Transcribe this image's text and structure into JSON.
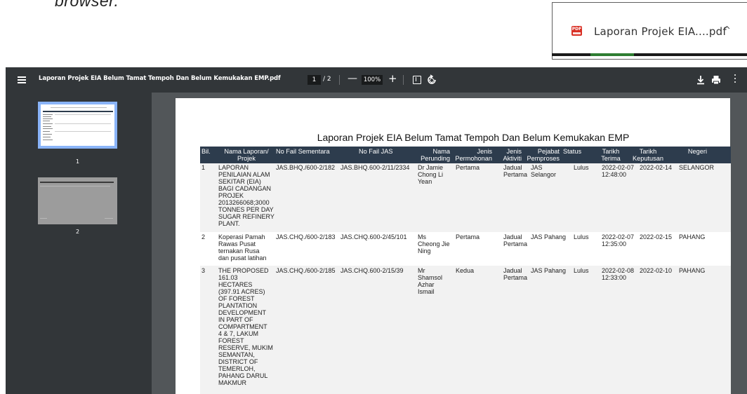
{
  "browser": {
    "cut_text": "browser.",
    "download": {
      "icon_label": "PDF",
      "file_name": "Laporan Projek EIA....pdf",
      "chevron": "^"
    }
  },
  "toolbar": {
    "file_title": "Laporan Projek EIA Belum Tamat Tempoh Dan Belum Kemukakan EMP.pdf",
    "page_current": "1",
    "page_total": "/ 2",
    "zoom_out": "—",
    "zoom": "100%",
    "zoom_in": "+"
  },
  "sidebar": {
    "thumbnails": [
      {
        "number": "1"
      },
      {
        "number": "2"
      }
    ]
  },
  "document": {
    "title": "Laporan Projek EIA Belum Tamat Tempoh Dan Belum Kemukakan EMP",
    "columns": [
      "Bil.",
      "Nama Laporan/\nProjek",
      "No Fail Sementara",
      "No Fail JAS",
      "Nama\nPerunding",
      "Jenis\nPermohonan",
      "Jenis\nAktiviti",
      "Pejabat\nPemproses",
      "Status",
      "Tarikh\nTerima",
      "Tarikh\nKeputusan",
      "Negeri"
    ],
    "rows": [
      [
        "1",
        "LAPORAN\nPENILAIAN ALAM\nSEKITAR (EIA)\nBAGI CADANGAN\nPROJEK\n2013266068;3000\nTONNES PER DAY\nSUGAR REFINERY\nPLANT.",
        "JAS.BHQ./600-2/182",
        "JAS.BHQ.600-2/11/2334",
        "Dr Jamie\nChong Li\nYean",
        "Pertama",
        "Jadual\nPertama",
        "JAS\nSelangor",
        "Lulus",
        "2022-02-07\n12:48:00",
        "2022-02-14",
        "SELANGOR"
      ],
      [
        "2",
        "Koperasi Pamah\nRawas Pusat\nternakan Rusa\ndan pusat latihan",
        "JAS.CHQ./600-2/183",
        "JAS.CHQ.600-2/45/101",
        "Ms\nCheong Jie\nNing",
        "Pertama",
        "Jadual\nPertama",
        "JAS Pahang",
        "Lulus",
        "2022-02-07\n12:35:00",
        "2022-02-15",
        "PAHANG"
      ],
      [
        "3",
        "THE PROPOSED\n161.03\nHECTARES\n(397.91 ACRES)\nOF FOREST\nPLANTATION\nDEVELOPMENT\nIN PART OF\nCOMPARTMENT\n4 & 7, LAKUM\nFOREST\nRESERVE, MUKIM\nSEMANTAN,\nDISTRICT OF\nTEMERLOH,\nPAHANG DARUL\nMAKMUR",
        "JAS.CHQ./600-2/185",
        "JAS.CHQ.600-2/15/39",
        "Mr\nShamsol\nAzhar\nIsmail",
        "Kedua",
        "Jadual\nPertama",
        "JAS Pahang",
        "Lulus",
        "2022-02-08\n12:33:00",
        "2022-02-10",
        "PAHANG"
      ]
    ]
  },
  "colors": {
    "viewer_bg": "#525659",
    "toolbar_bg": "#323639",
    "table_header_bg": "#2d3c4d",
    "row_alt_bg": "#f2f2f2",
    "thumb_selected": "#8ab4f8",
    "pdf_icon": "#d93025"
  },
  "icons": [
    "menu-icon",
    "fit-page-icon",
    "rotate-icon",
    "download-icon",
    "print-icon",
    "more-vert-icon",
    "pdf-file-icon",
    "chevron-up-icon"
  ]
}
